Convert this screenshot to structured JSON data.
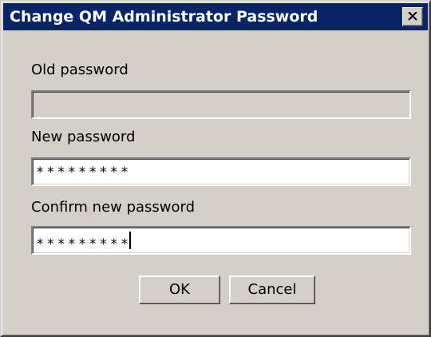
{
  "window": {
    "title": "Change QM Administrator Password"
  },
  "form": {
    "old_password": {
      "label": "Old password",
      "value": ""
    },
    "new_password": {
      "label": "New password",
      "value": "*********"
    },
    "confirm_password": {
      "label": "Confirm new password",
      "value": "*********"
    }
  },
  "buttons": {
    "ok_label": "OK",
    "cancel_label": "Cancel"
  },
  "icons": {
    "close": "close-icon"
  },
  "colors": {
    "titlebar": "#0a246a",
    "dialog_face": "#d4d0c8",
    "title_text": "#ffffff"
  }
}
